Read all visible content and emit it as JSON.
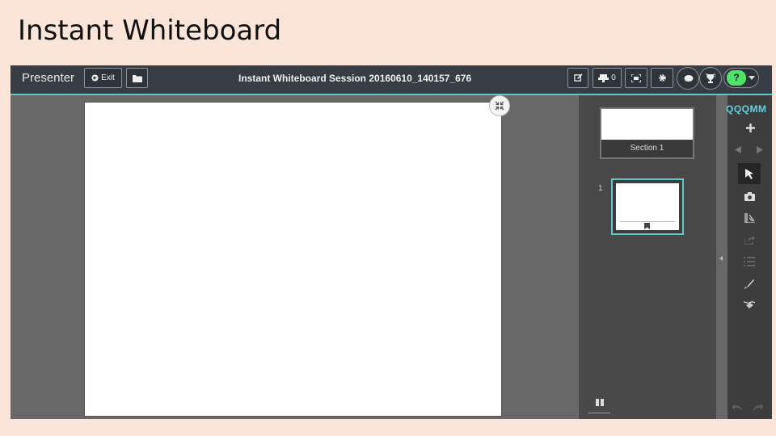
{
  "slide": {
    "title": "Instant Whiteboard"
  },
  "toolbar": {
    "brand": "Presenter",
    "exit_label": "Exit",
    "session_title": "Instant Whiteboard Session 20160610_140157_676",
    "participants_count": "0"
  },
  "panel": {
    "section_label": "Section 1",
    "slide_number": "1"
  },
  "tools": {
    "header_text": "QQQMM"
  },
  "colors": {
    "accent": "#5fc8c8",
    "help_green": "#50e36a",
    "topbar": "#383c44",
    "workspace": "#686868"
  }
}
